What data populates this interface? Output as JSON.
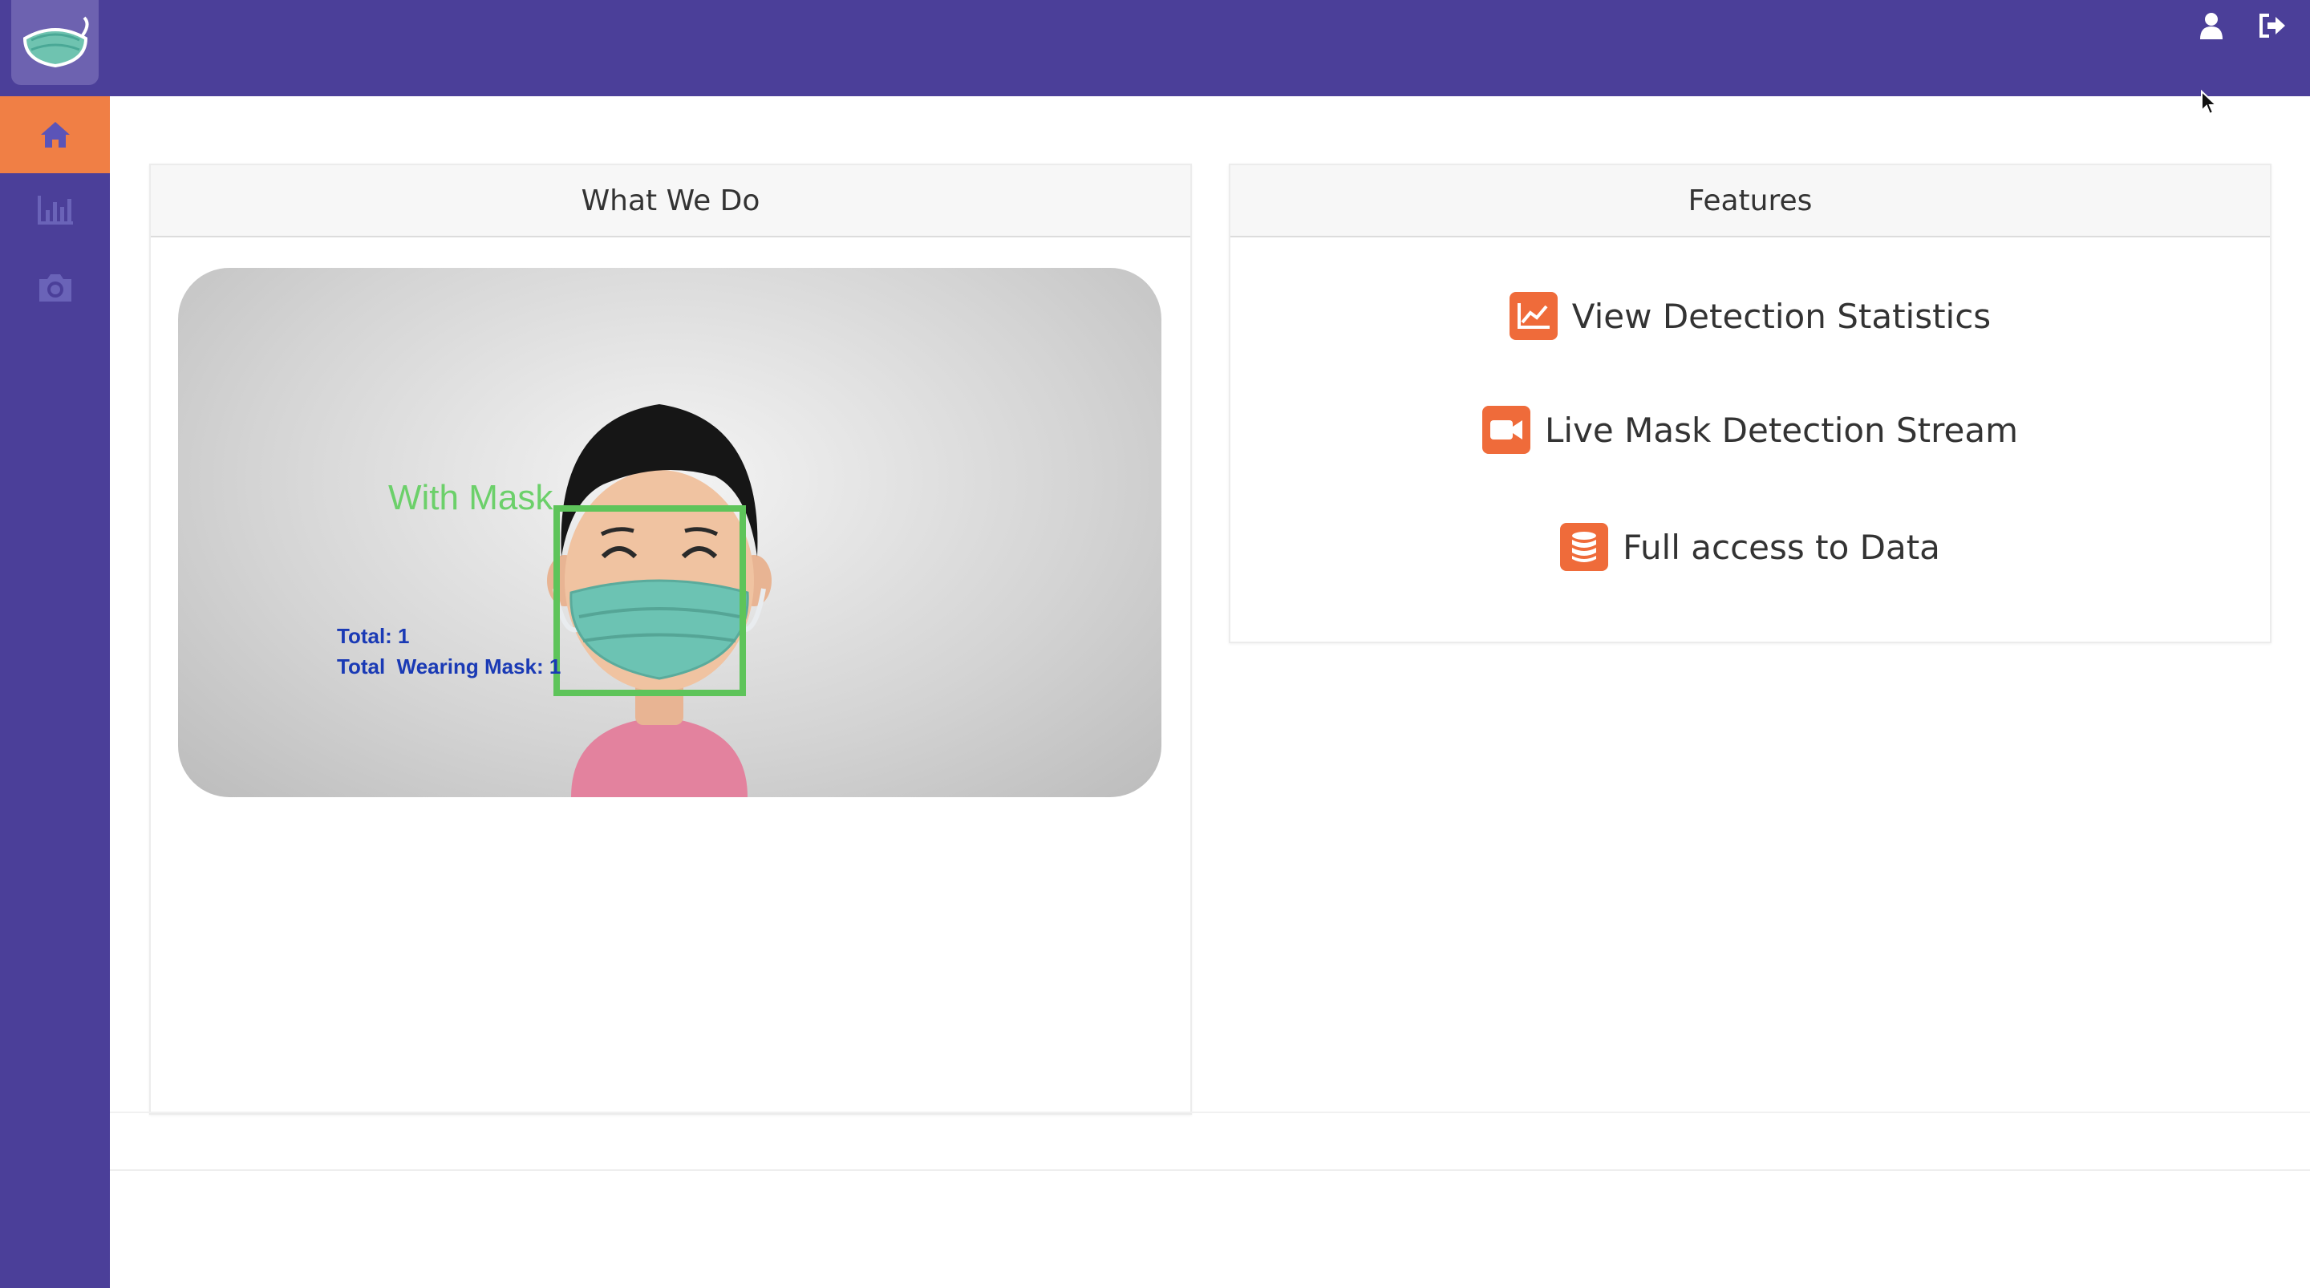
{
  "sidebar": {
    "logo": "mask-logo",
    "items": [
      {
        "icon": "home-icon",
        "active": true
      },
      {
        "icon": "bar-chart-icon",
        "active": false
      },
      {
        "icon": "camera-icon",
        "active": false
      }
    ]
  },
  "topbar": {
    "icons": [
      "user-icon",
      "sign-out-icon"
    ]
  },
  "what_we_do": {
    "title": "What We Do",
    "image": {
      "label": "With Mask",
      "total": "Total: 1",
      "total_wearing": "Total  Wearing Mask: 1"
    }
  },
  "features": {
    "title": "Features",
    "items": [
      {
        "icon": "line-chart-icon",
        "label": "View Detection Statistics"
      },
      {
        "icon": "video-camera-icon",
        "label": "Live Mask Detection Stream"
      },
      {
        "icon": "database-icon",
        "label": "Full access to Data"
      }
    ]
  },
  "colors": {
    "primary": "#4b3f99",
    "accent": "#f07f45",
    "feature_icon": "#ef6b3a"
  }
}
